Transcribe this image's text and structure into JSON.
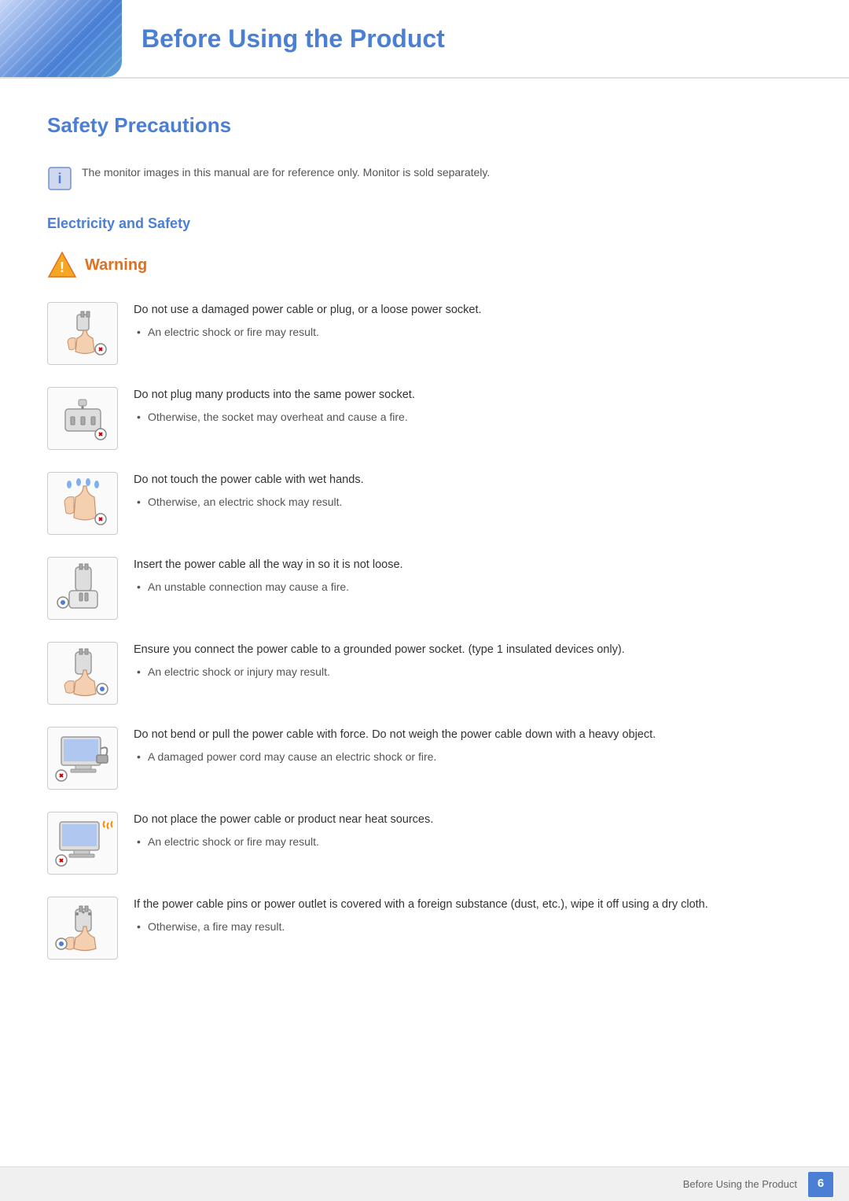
{
  "header": {
    "title": "Before Using the Product"
  },
  "safety": {
    "section_title": "Safety Precautions",
    "note": "The monitor images in this manual are for reference only. Monitor is sold separately.",
    "subsection": "Electricity and Safety",
    "warning_label": "Warning",
    "items": [
      {
        "id": 1,
        "main_text": "Do not use a damaged power cable or plug, or a loose power socket.",
        "sub_text": "An electric shock or fire may result.",
        "icon_type": "plug-hand"
      },
      {
        "id": 2,
        "main_text": "Do not plug many products into the same power socket.",
        "sub_text": "Otherwise, the socket may overheat and cause a fire.",
        "icon_type": "multi-plug"
      },
      {
        "id": 3,
        "main_text": "Do not touch the power cable with wet hands.",
        "sub_text": "Otherwise, an electric shock may result.",
        "icon_type": "wet-hands"
      },
      {
        "id": 4,
        "main_text": "Insert the power cable all the way in so it is not loose.",
        "sub_text": "An unstable connection may cause a fire.",
        "icon_type": "plug-insert"
      },
      {
        "id": 5,
        "main_text": "Ensure you connect the power cable to a grounded power socket. (type 1 insulated devices only).",
        "sub_text": "An electric shock or injury may result.",
        "icon_type": "grounded"
      },
      {
        "id": 6,
        "main_text": "Do not bend or pull the power cable with force. Do not weigh the power cable down with a heavy object.",
        "sub_text": "A damaged power cord may cause an electric shock or fire.",
        "icon_type": "monitor-bend"
      },
      {
        "id": 7,
        "main_text": "Do not place the power cable or product near heat sources.",
        "sub_text": "An electric shock or fire may result.",
        "icon_type": "monitor-heat"
      },
      {
        "id": 8,
        "main_text": "If the power cable pins or power outlet is covered with a foreign substance (dust, etc.), wipe it off using a dry cloth.",
        "sub_text": "Otherwise, a fire may result.",
        "icon_type": "plug-clean"
      }
    ]
  },
  "footer": {
    "text": "Before Using the Product",
    "page": "6"
  }
}
